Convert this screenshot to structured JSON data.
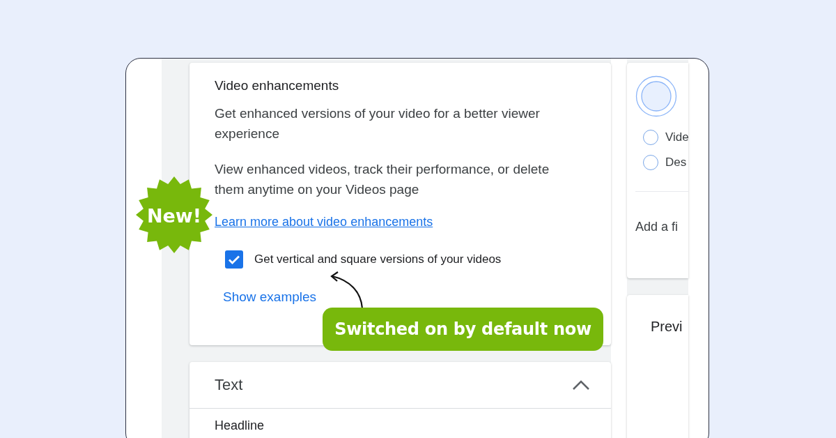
{
  "badge": {
    "text": "New!"
  },
  "callout": {
    "text": "Switched on by default now"
  },
  "enhancements_card": {
    "title": "Video enhancements",
    "description": "Get enhanced versions of your video for a better viewer experience",
    "note": "View enhanced videos, track their performance, or delete them anytime on your Videos page",
    "link": "Learn more about video enhancements",
    "checkbox": {
      "label": "Get vertical and square versions of your videos",
      "checked": true
    },
    "show_examples": "Show examples"
  },
  "text_section": {
    "title": "Text",
    "expanded": true,
    "field_label": "Headline"
  },
  "side_panel": {
    "options": [
      {
        "label": "Vide",
        "selected": false
      },
      {
        "label": "Des",
        "selected": false
      }
    ],
    "add_prompt": "Add a fi",
    "preview_title": "Previ"
  }
}
